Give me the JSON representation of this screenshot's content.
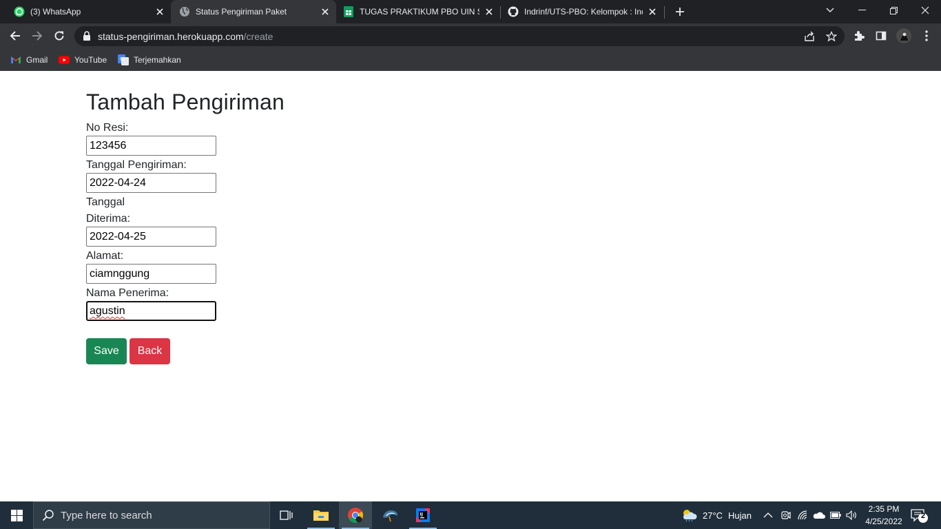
{
  "browser": {
    "tabs": [
      {
        "title": "(3) WhatsApp",
        "icon": "whatsapp-icon",
        "active": false
      },
      {
        "title": "Status Pengiriman Paket",
        "icon": "globe-icon",
        "active": true
      },
      {
        "title": "TUGAS PRAKTIKUM PBO UIN SGD",
        "icon": "google-sheets-icon",
        "active": false
      },
      {
        "title": "Indrinf/UTS-PBO: Kelompok : Indrinf",
        "icon": "github-icon",
        "active": false
      }
    ],
    "url_host": "status-pengiriman.herokuapp.com",
    "url_path": "/create",
    "bookmarks": [
      {
        "label": "Gmail",
        "icon": "gmail-icon"
      },
      {
        "label": "YouTube",
        "icon": "youtube-icon"
      },
      {
        "label": "Terjemahkan",
        "icon": "google-translate-icon"
      }
    ]
  },
  "form": {
    "heading": "Tambah Pengiriman",
    "no_resi_label": "No Resi:",
    "no_resi_value": "123456",
    "tanggal_pengiriman_label": "Tanggal Pengiriman:",
    "tanggal_pengiriman_value": "2022-04-24",
    "tanggal_diterima_label_line1": "Tanggal",
    "tanggal_diterima_label_line2": "Diterima:",
    "tanggal_diterima_value": "2022-04-25",
    "alamat_label": "Alamat:",
    "alamat_value": "ciamnggung",
    "nama_penerima_label": "Nama Penerima:",
    "nama_penerima_value": "agustin",
    "save_label": "Save",
    "back_label": "Back"
  },
  "taskbar": {
    "search_placeholder": "Type here to search",
    "weather_temp": "27°C",
    "weather_desc": "Hujan",
    "time": "2:35 PM",
    "date": "4/25/2022",
    "notification_count": "2"
  },
  "colors": {
    "save": "#198754",
    "back": "#dc3545",
    "chrome_dark": "#202124",
    "chrome_toolbar": "#35363a",
    "taskbar": "#1f2e3a"
  }
}
